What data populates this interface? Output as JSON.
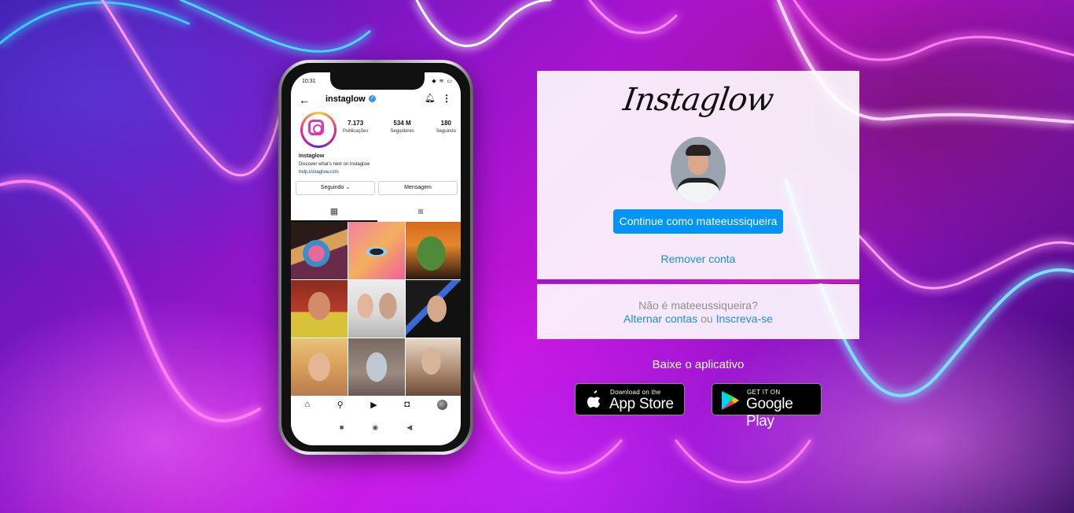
{
  "phone": {
    "status_time": "10:31",
    "status_icons": "◆ ≋ ▭",
    "username": "instaglow",
    "verified_icon": "✓",
    "stats": [
      {
        "value": "7.173",
        "label": "Publicações"
      },
      {
        "value": "534 M",
        "label": "Seguidores"
      },
      {
        "value": "180",
        "label": "Seguindo"
      }
    ],
    "bio_name": "Instaglow",
    "bio_text": "Discover what's next on Instaglow",
    "bio_link": "help.instaglow.com",
    "following_button": "Seguindo ⌄",
    "message_button": "Mensagem",
    "tab_grid_icon": "▦",
    "tab_tagged_icon": "◙",
    "nav_icons": [
      "⌂",
      "⚲",
      "▶",
      "◘"
    ],
    "android_nav": [
      "■",
      "◉",
      "◀"
    ]
  },
  "login": {
    "logo": "Instaglow",
    "continue_button": "Continue como mateeussiqueira",
    "remove_account": "Remover conta",
    "not_you": "Não é mateeussiqueira?",
    "switch_accounts": "Alternar contas",
    "or": "ou",
    "sign_up": "Inscreva-se"
  },
  "app": {
    "get_app": "Baixe o aplicativo",
    "apple_small": "Download on the",
    "apple_big": "App Store",
    "google_small": "GET IT ON",
    "google_big": "Google Play"
  },
  "colors": {
    "primary_button": "#0095f6",
    "link": "#1a8fd8",
    "divider": "#d21ad2"
  }
}
